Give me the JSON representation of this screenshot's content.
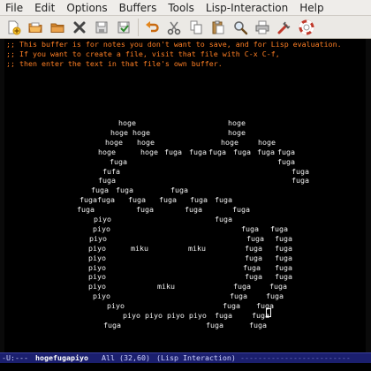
{
  "menubar": [
    "File",
    "Edit",
    "Options",
    "Buffers",
    "Tools",
    "Lisp-Interaction",
    "Help"
  ],
  "toolbar": {
    "icons": [
      "new-file-icon",
      "open-folder-icon",
      "open-directory-icon",
      "close-buffer-icon",
      "save-icon",
      "save-as-icon",
      "undo-icon",
      "cut-icon",
      "copy-icon",
      "paste-icon",
      "search-icon",
      "print-icon",
      "preferences-icon",
      "help-icon"
    ]
  },
  "editor": {
    "comments": [
      ";; This buffer is for notes you don't want to save, and for Lisp evaluation.",
      ";; If you want to create a file, visit that file with C-x C-f,",
      ";; then enter the text in that file's own buffer."
    ],
    "art_rows": [
      [
        "hoge",
        "hoge"
      ],
      [
        "hoge hoge",
        "hoge"
      ],
      [
        "hoge",
        "hoge",
        "hoge",
        "hoge"
      ],
      [
        "hoge",
        "hoge",
        "fuga",
        "fuga",
        "fuga",
        "fuga",
        "fuga",
        "fuga"
      ],
      [
        "fuga",
        "fuga"
      ],
      [
        "fufa",
        "fuga"
      ],
      [
        "fuga",
        "fuga"
      ],
      [
        "fuga",
        "fuga",
        "fuga"
      ],
      [
        "fugafuga",
        "fuga",
        "fuga",
        "fuga",
        "fuga"
      ],
      [
        "fuga",
        "fuga",
        "fuga",
        "fuga"
      ],
      [
        "piyo",
        "fuga"
      ],
      [
        "piyo",
        "fuga",
        "fuga"
      ],
      [
        "piyo",
        "fuga",
        "fuga"
      ],
      [
        "piyo",
        "miku",
        "miku",
        "fuga",
        "fuga"
      ],
      [
        "piyo",
        "fuga",
        "fuga"
      ],
      [
        "piyo",
        "fuga",
        "fuga"
      ],
      [
        "piyo",
        "fuga",
        "fuga"
      ],
      [
        "piyo",
        "miku",
        "fuga",
        "fuga"
      ],
      [
        "piyo",
        "fuga",
        "fuga"
      ],
      [
        "piyo",
        "fuga",
        "fuga"
      ],
      [
        "piyo piyo piyo piyo",
        "fuga",
        "fuga"
      ],
      [
        "fuga",
        "fuga",
        "fuga"
      ]
    ]
  },
  "modeline": {
    "status": "-U:---",
    "buffer": "hogefugapiyo",
    "position": "All (32,60)",
    "mode": "(Lisp Interaction)"
  },
  "colors": {
    "comment": "#ff7f24",
    "text": "#f2f2f2",
    "background": "#000000",
    "modeline": "#1b1f6e"
  }
}
